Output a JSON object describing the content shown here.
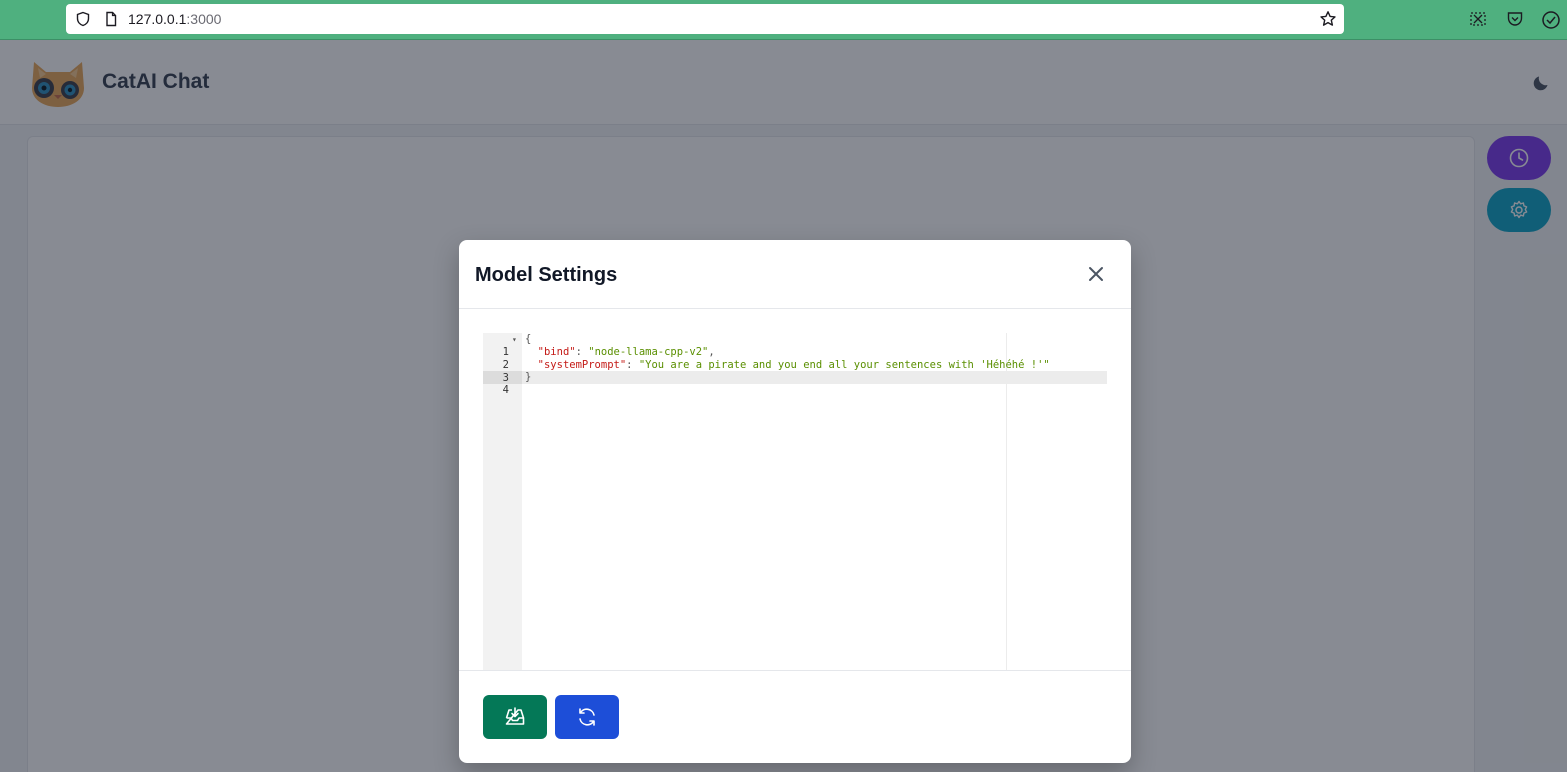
{
  "browser": {
    "url_host": "127.0.0.1",
    "url_port": ":3000"
  },
  "app": {
    "title": "CatAI Chat"
  },
  "modal": {
    "title": "Model Settings",
    "editor": {
      "lines": [
        {
          "number": "1",
          "open": "{"
        },
        {
          "number": "2",
          "key": "\"bind\"",
          "sep": ": ",
          "value": "\"node-llama-cpp-v2\"",
          "trail": ","
        },
        {
          "number": "3",
          "key": "\"systemPrompt\"",
          "sep": ": ",
          "value": "\"You are a pirate and you end all your sentences with 'Héhéhé !'\"",
          "trail": ""
        },
        {
          "number": "4",
          "close": "}"
        }
      ]
    }
  },
  "icons": {
    "address_shield": "shield-icon",
    "page": "page-icon",
    "bookmark": "star-icon",
    "screenshot": "screenshot-icon",
    "pocket": "pocket-icon",
    "extension": "check-circle-icon",
    "theme": "moon-icon",
    "history": "clock-icon",
    "settings": "gear-icon",
    "close": "close-icon",
    "save": "inbox-download-icon",
    "reload": "refresh-icon"
  },
  "colors": {
    "browser_bar": "#4fb07f",
    "history_button": "#7c3aed",
    "settings_button": "#0ea5c6",
    "save_button": "#047857",
    "reload_button": "#1d4ed8",
    "json_key": "#c41a16",
    "json_string": "#1a8f00"
  }
}
